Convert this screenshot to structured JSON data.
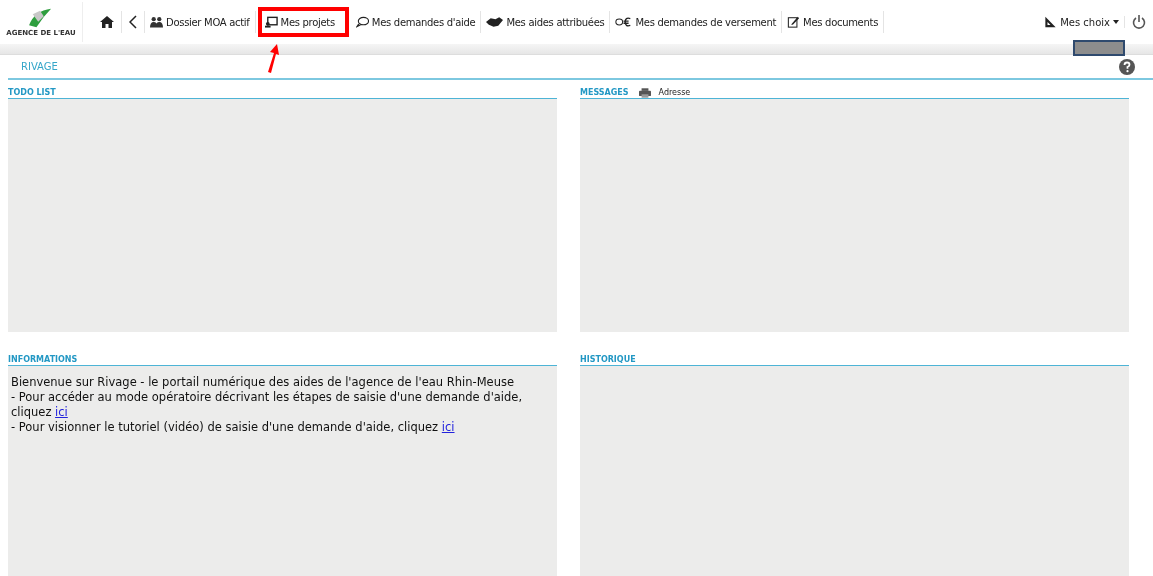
{
  "logo": {
    "text": "AGENCE DE L'EAU"
  },
  "nav": [
    {
      "kind": "home"
    },
    {
      "kind": "back"
    },
    {
      "kind": "people",
      "label": "Dossier MOA actif",
      "highlighted": false
    },
    {
      "kind": "screen",
      "label": "Mes projets",
      "highlighted": true
    },
    {
      "kind": "bubble",
      "label": "Mes demandes d'aide",
      "highlighted": false
    },
    {
      "kind": "handshake",
      "label": "Mes aides attribuées",
      "highlighted": false
    },
    {
      "kind": "euro",
      "label": "Mes demandes de versement",
      "highlighted": false
    },
    {
      "kind": "edit",
      "label": "Mes documents",
      "highlighted": false
    }
  ],
  "user_menu": {
    "label": "Mes choix"
  },
  "page_title": "RIVAGE",
  "panels": [
    {
      "title": "TODO LIST"
    },
    {
      "title": "MESSAGES",
      "print_label": "Adresse"
    },
    {
      "title": "INFORMATIONS",
      "lines": [
        {
          "text": "Bienvenue sur Rivage - le portail numérique des aides de l'agence de l'eau Rhin-Meuse"
        },
        {
          "text": "- Pour accéder au mode opératoire décrivant les étapes de saisie d'une demande d'aide, cliquez",
          "link": "ici"
        },
        {
          "text": "- Pour visionner le tutoriel (vidéo) de saisie d'une demande d'aide, cliquez",
          "link": "ici"
        }
      ]
    },
    {
      "title": "HISTORIQUE"
    }
  ]
}
